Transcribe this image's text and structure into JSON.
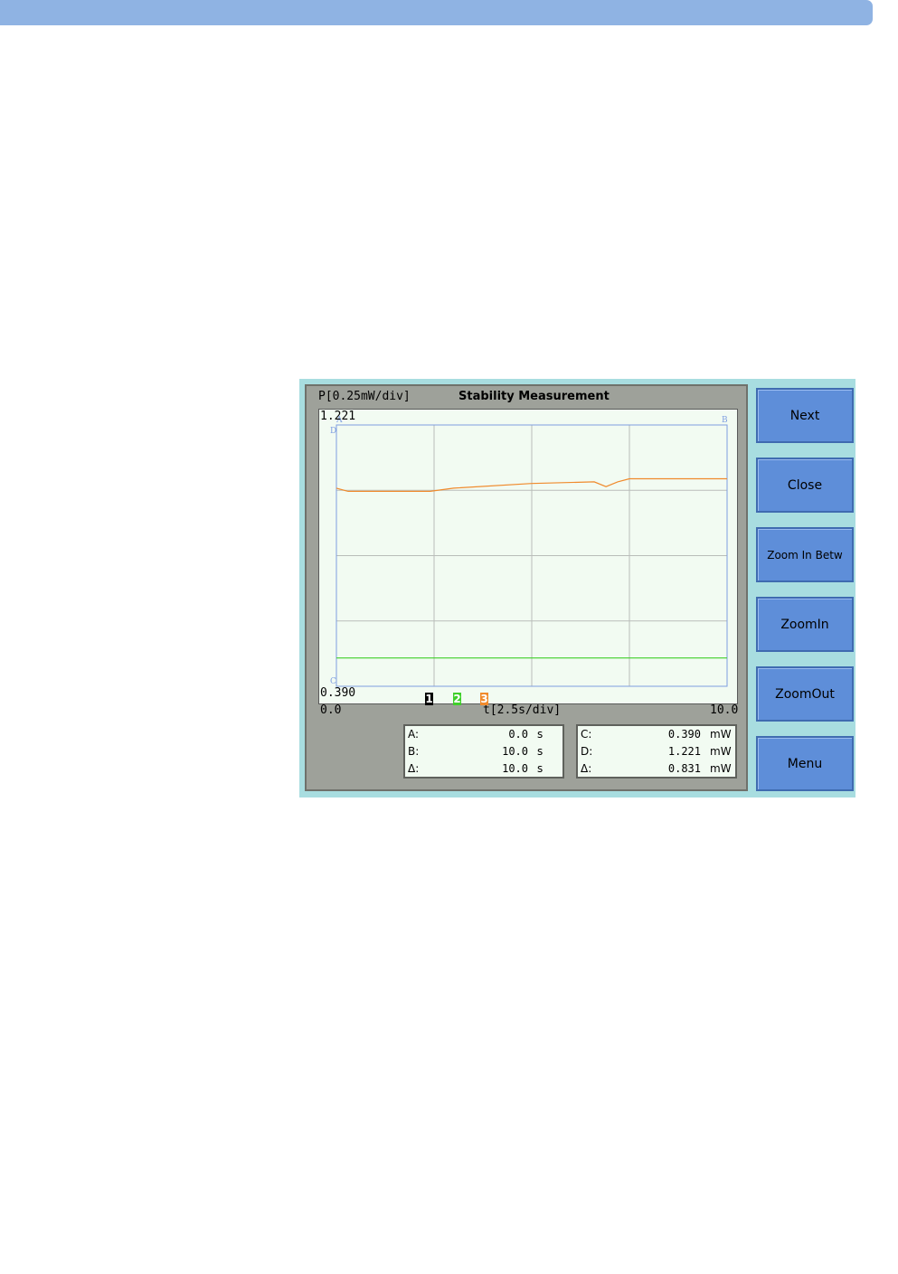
{
  "screen": {
    "title": "Stability Measurement",
    "y_scale_label": "P[0.25mW/div]",
    "x_scale_label": "t[2.5s/div]",
    "y_top_value": "1.221",
    "y_bottom_value": "0.390",
    "x_left_value": "0.0",
    "x_right_value": "10.0",
    "cursor_labels": {
      "a": "A",
      "b": "B",
      "c": "C",
      "d": "D"
    },
    "trace_markers": [
      {
        "label": "1",
        "color": "#000000"
      },
      {
        "label": "2",
        "color": "#3fcf2a"
      },
      {
        "label": "3",
        "color": "#f08a2c"
      }
    ]
  },
  "readouts": {
    "time": {
      "rows": [
        {
          "name": "A:",
          "value": "0.0",
          "unit": "s"
        },
        {
          "name": "B:",
          "value": "10.0",
          "unit": "s"
        },
        {
          "name": "Δ:",
          "value": "10.0",
          "unit": "s"
        }
      ]
    },
    "power": {
      "rows": [
        {
          "name": "C:",
          "value": "0.390",
          "unit": "mW"
        },
        {
          "name": "D:",
          "value": "1.221",
          "unit": "mW"
        },
        {
          "name": "Δ:",
          "value": "0.831",
          "unit": "mW"
        }
      ]
    }
  },
  "softkeys": [
    "Next",
    "Close",
    "Zoom In Betw",
    "ZoomIn",
    "ZoomOut",
    "Menu"
  ],
  "chart_data": {
    "type": "line",
    "xlabel": "t[2.5s/div]",
    "ylabel": "P[0.25mW/div]",
    "title": "Stability Measurement",
    "xlim": [
      0,
      10
    ],
    "ylim": [
      0.39,
      1.221
    ],
    "grid": true,
    "series": [
      {
        "name": "3",
        "color": "#f08a2c",
        "x": [
          0.0,
          0.3,
          2.4,
          3.0,
          5.0,
          6.6,
          6.9,
          7.2,
          7.5,
          10.0
        ],
        "y": [
          1.02,
          1.01,
          1.01,
          1.02,
          1.035,
          1.04,
          1.025,
          1.04,
          1.05,
          1.05
        ]
      },
      {
        "name": "2",
        "color": "#3fcf2a",
        "x": [
          0.0,
          10.0
        ],
        "y": [
          0.48,
          0.48
        ]
      }
    ]
  }
}
